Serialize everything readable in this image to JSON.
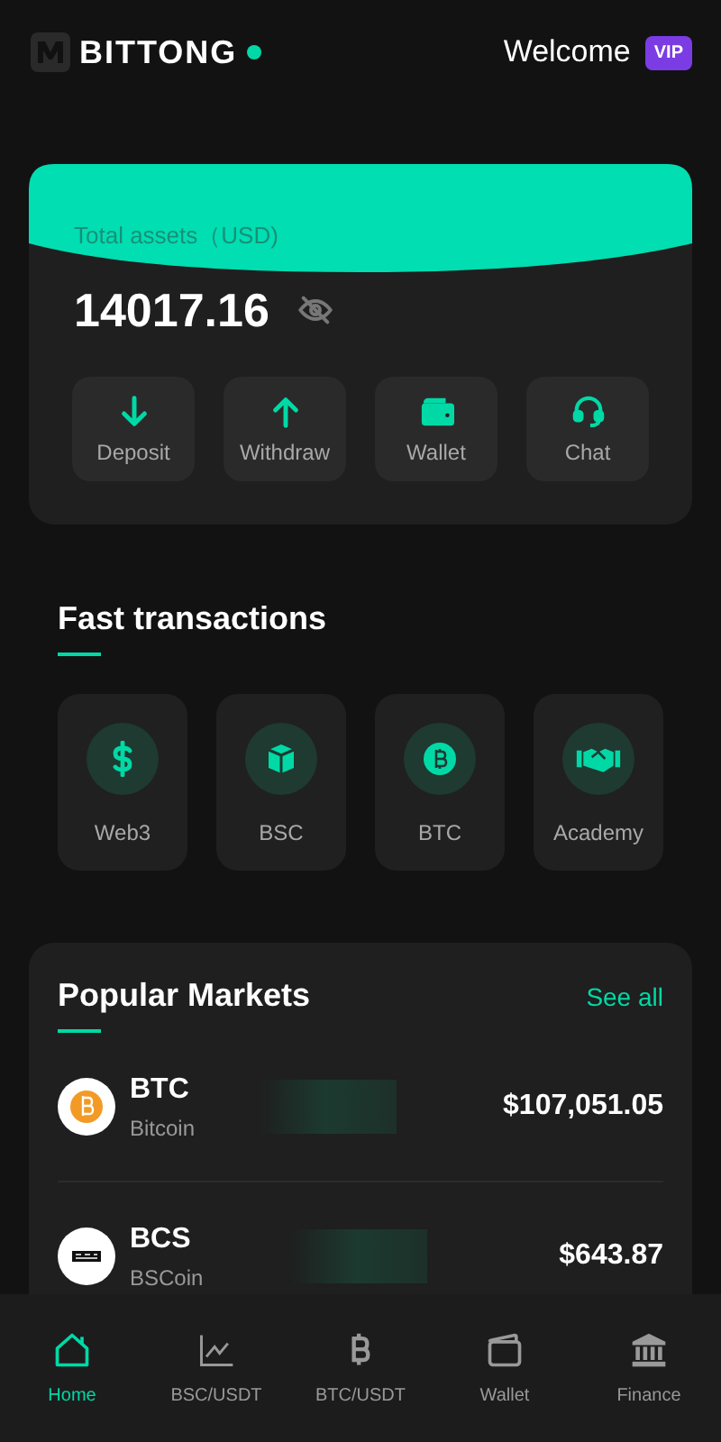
{
  "header": {
    "brand": "BITTONG",
    "welcome": "Welcome",
    "badge": "VIP"
  },
  "assets": {
    "label": "Total assets（USD)",
    "amount": "14017.16",
    "hidden": false,
    "actions": [
      {
        "label": "Deposit",
        "kind": "deposit"
      },
      {
        "label": "Withdraw",
        "kind": "withdraw"
      },
      {
        "label": "Wallet",
        "kind": "wallet"
      },
      {
        "label": "Chat",
        "kind": "chat"
      }
    ]
  },
  "fast": {
    "title": "Fast transactions",
    "items": [
      {
        "label": "Web3",
        "kind": "dollar"
      },
      {
        "label": "BSC",
        "kind": "cube"
      },
      {
        "label": "BTC",
        "kind": "bitcoin"
      },
      {
        "label": "Academy",
        "kind": "handshake"
      }
    ]
  },
  "markets": {
    "title": "Popular Markets",
    "link": "See all",
    "rows": [
      {
        "symbol": "BTC",
        "name": "Bitcoin",
        "price": "$107,051.05",
        "kind": "btc"
      },
      {
        "symbol": "BCS",
        "name": "BSCoin",
        "price": "$643.87",
        "kind": "bsc"
      }
    ]
  },
  "nav": [
    {
      "label": "Home",
      "kind": "home",
      "selected": true
    },
    {
      "label": "BSC/USDT",
      "kind": "chart",
      "selected": false
    },
    {
      "label": "BTC/USDT",
      "kind": "bitcoin",
      "selected": false
    },
    {
      "label": "Wallet",
      "kind": "wallet",
      "selected": false
    },
    {
      "label": "Finance",
      "kind": "bank",
      "selected": false
    }
  ]
}
